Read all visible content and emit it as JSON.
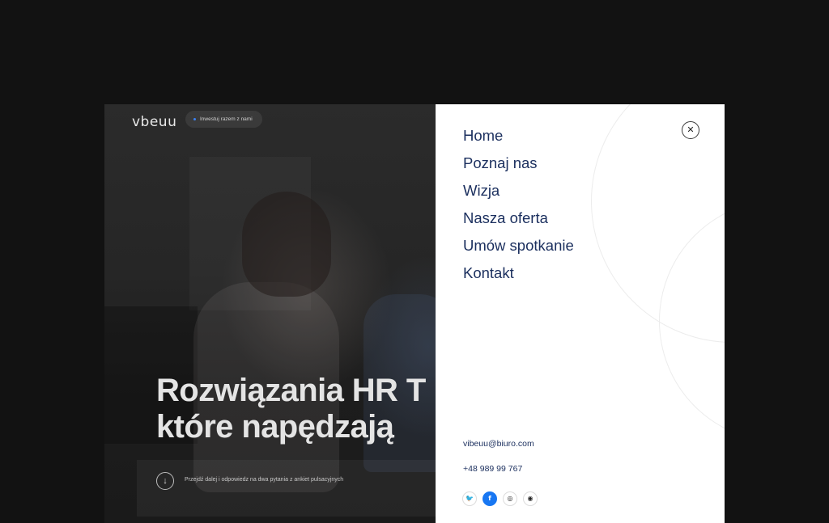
{
  "header": {
    "logo": "vbeuu",
    "pill_label": "Inwestuj razem z nami",
    "pill_dot_color": "#3b82f6"
  },
  "hero": {
    "headline_line1": "Rozwiązania HR T",
    "headline_line2": "które napędzają",
    "scroll_icon": "arrow-down-icon",
    "scroll_glyph": "↓",
    "scroll_text": "Przejdź dalej i odpowiedz na dwa pytania z ankiet pulsacyjnych"
  },
  "menu": {
    "close_icon": "close-icon",
    "close_glyph": "✕",
    "items": [
      {
        "label": "Home"
      },
      {
        "label": "Poznaj nas"
      },
      {
        "label": "Wizja"
      },
      {
        "label": "Nasza oferta"
      },
      {
        "label": "Umów spotkanie"
      },
      {
        "label": "Kontakt"
      }
    ],
    "email": "vibeuu@biuro.com",
    "phone": "+48 989 99 767",
    "socials": [
      {
        "icon": "twitter-icon",
        "glyph": "🐦"
      },
      {
        "icon": "facebook-icon",
        "glyph": "f"
      },
      {
        "icon": "instagram-icon",
        "glyph": "◎"
      },
      {
        "icon": "github-icon",
        "glyph": "◉"
      }
    ],
    "link_color": "#1b2f5e",
    "active_social_color": "#1877f2"
  }
}
